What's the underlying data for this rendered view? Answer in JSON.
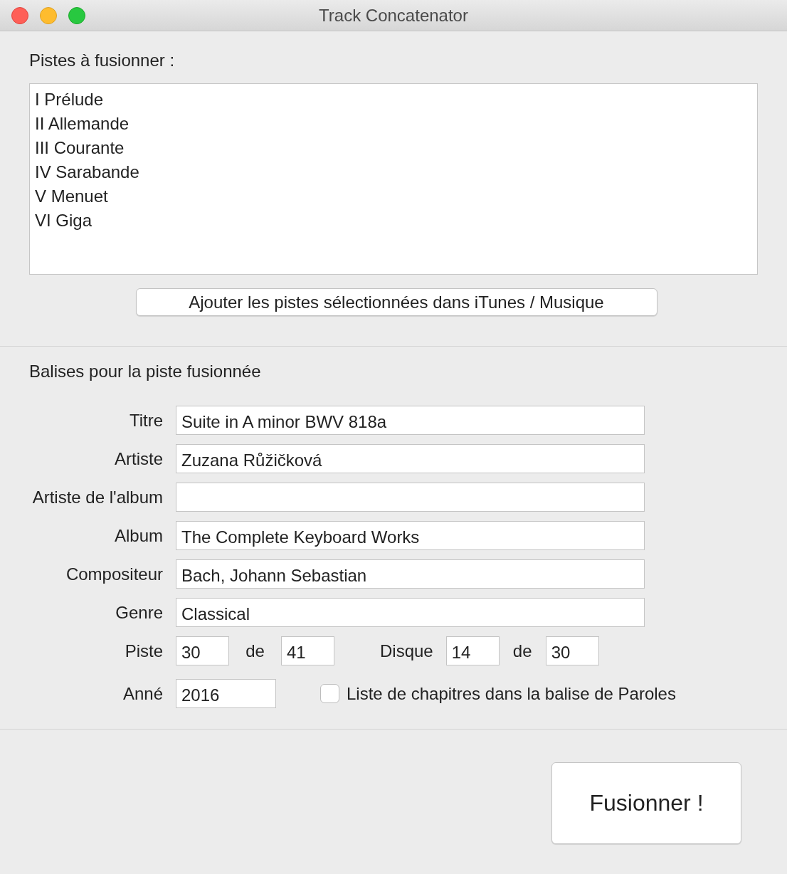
{
  "window": {
    "title": "Track Concatenator"
  },
  "tracks_section": {
    "label": "Pistes à fusionner :",
    "tracks": [
      {
        "name": "I Prélude"
      },
      {
        "name": "II Allemande"
      },
      {
        "name": "III Courante"
      },
      {
        "name": "IV Sarabande"
      },
      {
        "name": "V Menuet"
      },
      {
        "name": "VI Giga"
      }
    ],
    "add_button": "Ajouter les pistes sélectionnées dans iTunes / Musique"
  },
  "tags_section": {
    "label": "Balises pour la piste fusionnée",
    "fields": [
      {
        "label": "Titre",
        "value": "Suite in A minor BWV 818a"
      },
      {
        "label": "Artiste",
        "value": "Zuzana Růžičková"
      },
      {
        "label": "Artiste de l'album"
      },
      {
        "label": "Album",
        "value": "The Complete Keyboard Works"
      },
      {
        "label": "Compositeur",
        "value": "Bach, Johann Sebastian"
      },
      {
        "label": "Genre",
        "value": "Classical"
      }
    ],
    "track": {
      "label": "Piste",
      "number": "30",
      "of_label": "de",
      "total": "41"
    },
    "disc": {
      "label": "Disque",
      "number": "14",
      "of_label": "de",
      "total": "30"
    },
    "year": {
      "label": "Anné",
      "value": "2016"
    },
    "chapters_checkbox": {
      "label": "Liste de chapitres dans la balise de Paroles",
      "checked": false
    }
  },
  "merge_button": "Fusionner !"
}
